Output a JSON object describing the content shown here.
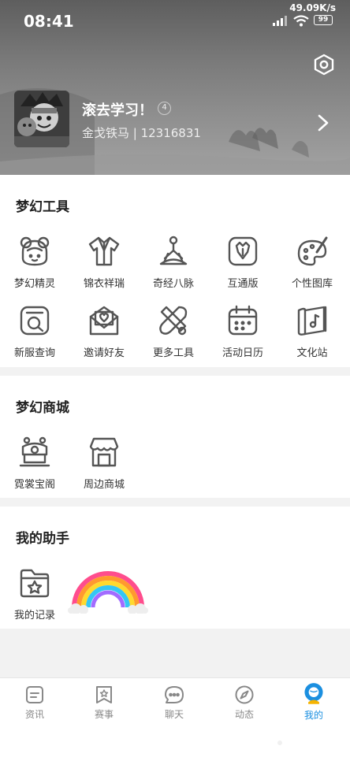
{
  "status": {
    "time": "08:41",
    "net_speed": "49.09K/s",
    "battery": "99"
  },
  "profile": {
    "nickname": "滚去学习！",
    "level": "4",
    "subinfo": "金戈铁马 | 12316831"
  },
  "sections": {
    "tools": {
      "title": "梦幻工具",
      "items": [
        {
          "label": "梦幻精灵",
          "icon": "sprite-girl-icon"
        },
        {
          "label": "锦衣祥瑞",
          "icon": "robe-icon"
        },
        {
          "label": "奇经八脉",
          "icon": "meditation-icon"
        },
        {
          "label": "互通版",
          "icon": "interop-icon"
        },
        {
          "label": "个性图库",
          "icon": "palette-icon"
        },
        {
          "label": "新服查询",
          "icon": "server-search-icon"
        },
        {
          "label": "邀请好友",
          "icon": "invite-mail-icon"
        },
        {
          "label": "更多工具",
          "icon": "tools-icon"
        },
        {
          "label": "活动日历",
          "icon": "calendar-icon"
        },
        {
          "label": "文化站",
          "icon": "culture-scroll-icon"
        }
      ]
    },
    "mall": {
      "title": "梦幻商城",
      "items": [
        {
          "label": "霓裳宝阁",
          "icon": "treasure-shop-icon"
        },
        {
          "label": "周边商城",
          "icon": "store-icon"
        }
      ]
    },
    "assistant": {
      "title": "我的助手",
      "items": [
        {
          "label": "我的记录",
          "icon": "record-folder-icon"
        }
      ]
    }
  },
  "tabbar": {
    "active": "我的",
    "items": [
      {
        "label": "资讯",
        "icon": "news-icon"
      },
      {
        "label": "赛事",
        "icon": "match-icon"
      },
      {
        "label": "聊天",
        "icon": "chat-icon"
      },
      {
        "label": "动态",
        "icon": "compass-icon"
      },
      {
        "label": "我的",
        "icon": "profile-icon"
      }
    ]
  },
  "colors": {
    "accent": "#1b8fe0",
    "header_gray": "#7a7a7a",
    "page_bg": "#f2f2f2"
  }
}
